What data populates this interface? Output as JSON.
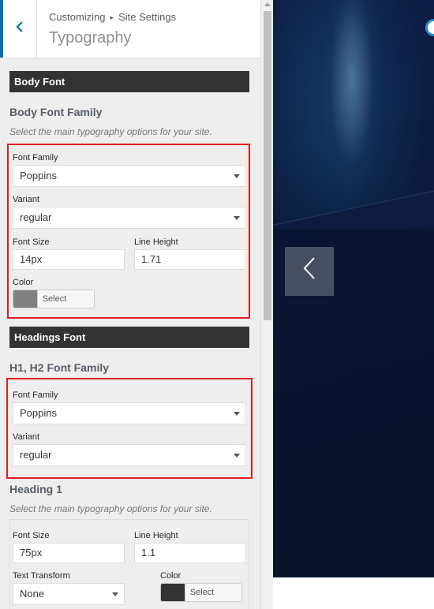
{
  "header": {
    "back_icon": "chevron-left-icon",
    "breadcrumb_root": "Customizing",
    "breadcrumb_separator": "▸",
    "breadcrumb_parent": "Site Settings",
    "title": "Typography"
  },
  "body_font": {
    "section_label": "Body Font",
    "heading": "Body Font Family",
    "description": "Select the main typography options for your site.",
    "font_family_label": "Font Family",
    "font_family_value": "Poppins",
    "variant_label": "Variant",
    "variant_value": "regular",
    "font_size_label": "Font Size",
    "font_size_value": "14px",
    "line_height_label": "Line Height",
    "line_height_value": "1.71",
    "color_label": "Color",
    "color_button": "Select Color",
    "color_swatch": "#808080"
  },
  "headings_font": {
    "section_label": "Headings Font",
    "heading": "H1, H2 Font Family",
    "font_family_label": "Font Family",
    "font_family_value": "Poppins",
    "variant_label": "Variant",
    "variant_value": "regular"
  },
  "heading1": {
    "heading": "Heading 1",
    "description": "Select the main typography options for your site.",
    "font_size_label": "Font Size",
    "font_size_value": "75px",
    "line_height_label": "Line Height",
    "line_height_value": "1.1",
    "text_transform_label": "Text Transform",
    "text_transform_value": "None",
    "color_label": "Color",
    "color_button": "Select Color",
    "color_swatch": "#333333"
  },
  "preview": {
    "prev_icon": "chevron-left-icon"
  },
  "colors": {
    "accent": "#0073aa",
    "highlight_box": "#e31c1c",
    "section_bar": "#333333"
  }
}
